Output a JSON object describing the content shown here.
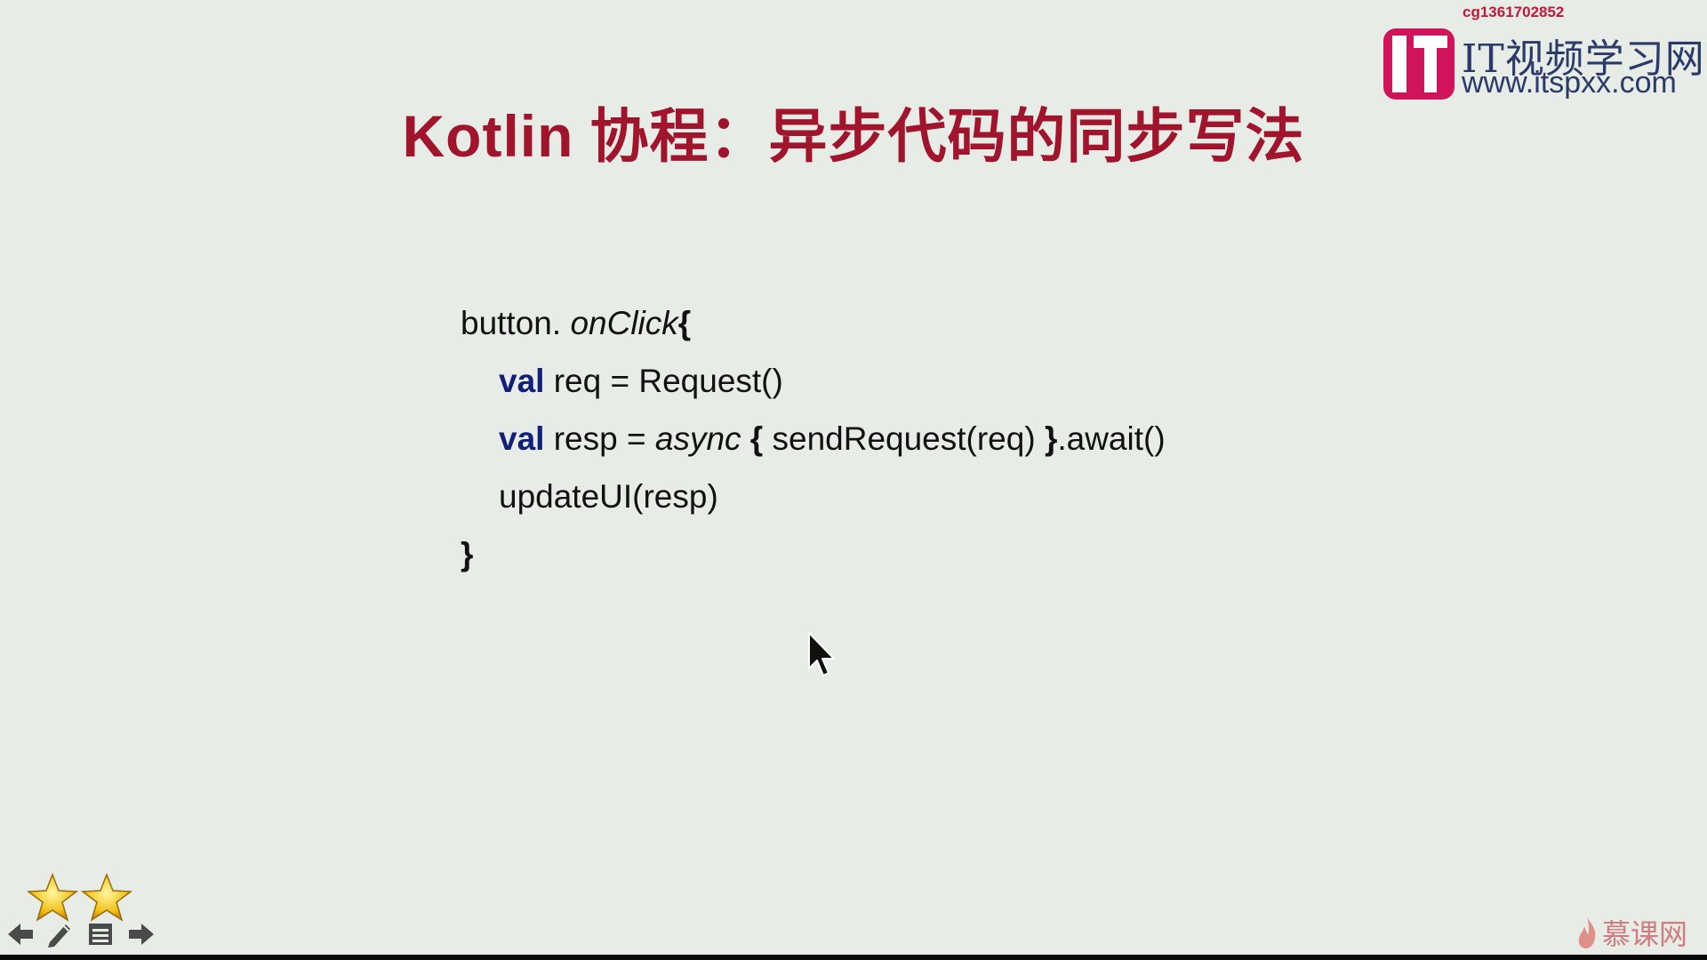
{
  "slide": {
    "title_en": "Kotlin",
    "title_cn": "协程：异步代码的同步写法"
  },
  "watermark": {
    "id": "cg1361702852",
    "site_name": "IT视频学习网",
    "site_url": "www.itspxx.com"
  },
  "code": {
    "line1_obj": "button.",
    "line1_fn": "onClick",
    "line1_brace": "{",
    "line2_kw": "val",
    "line2_rest": " req = Request()",
    "line3_kw": "val",
    "line3_mid": " resp = ",
    "line3_async": "async",
    "line3_open": " { ",
    "line3_call": "sendRequest(req) ",
    "line3_close": "}",
    "line3_tail": ".await()",
    "line4": "updateUI(resp)",
    "line5": "}"
  },
  "controls": {
    "icons": [
      "star-icon",
      "star-icon",
      "arrow-left-icon",
      "pencil-icon",
      "menu-icon",
      "arrow-right-icon"
    ]
  },
  "brand": {
    "text": "慕课网",
    "icon": "flame-icon"
  },
  "colors": {
    "background": "#e8ece6",
    "title": "#a0142c",
    "keyword": "#0f1f7a",
    "watermark_text": "#2a3a6a",
    "watermark_logo": "#d0145c",
    "brand": "#cf7d80"
  }
}
